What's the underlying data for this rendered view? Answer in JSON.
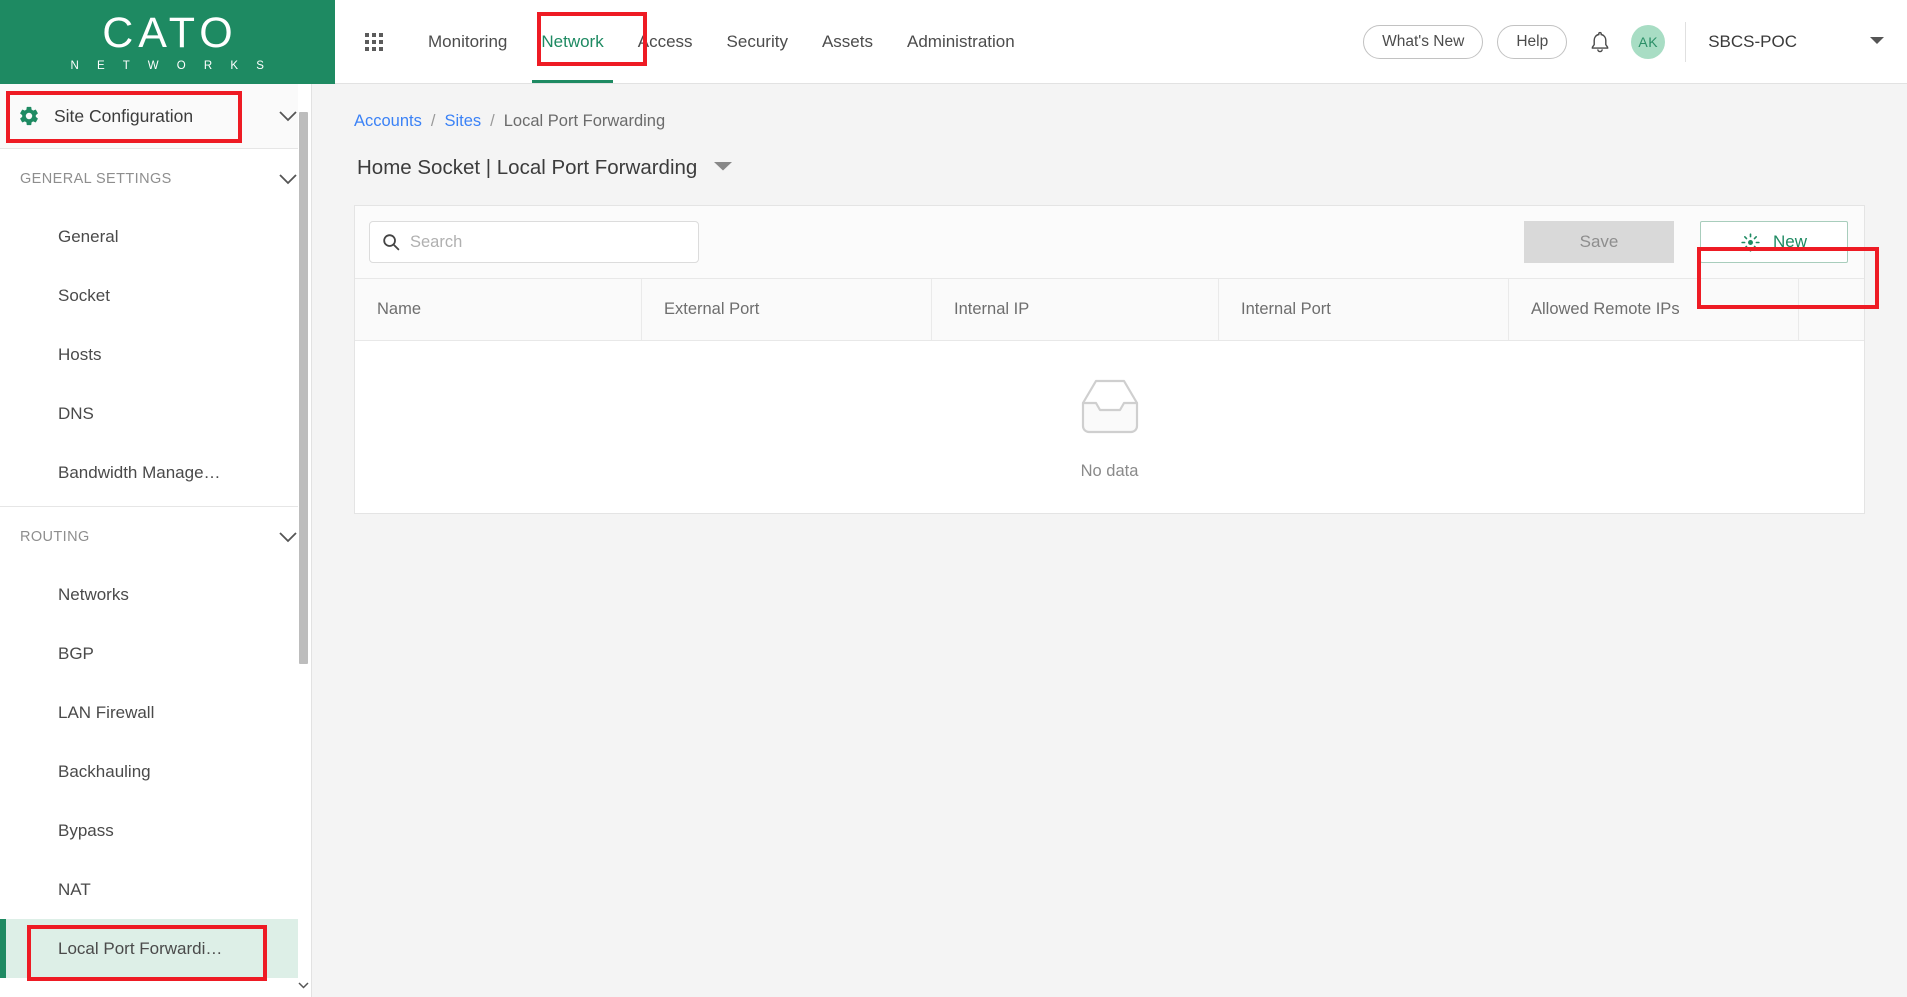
{
  "brand": {
    "name": "CATO",
    "tagline": "N E T W O R K S"
  },
  "topnav": {
    "apps_icon": "grid-apps-icon",
    "items": [
      {
        "label": "Monitoring",
        "active": false
      },
      {
        "label": "Network",
        "active": true
      },
      {
        "label": "Access",
        "active": false
      },
      {
        "label": "Security",
        "active": false
      },
      {
        "label": "Assets",
        "active": false
      },
      {
        "label": "Administration",
        "active": false
      }
    ],
    "whats_new_label": "What's New",
    "help_label": "Help",
    "notifications_icon": "bell-icon",
    "avatar_initials": "AK",
    "account_name": "SBCS-POC",
    "account_caret_icon": "chevron-down-icon"
  },
  "sidebar": {
    "header": {
      "label": "Site Configuration",
      "icon": "gear-icon",
      "caret_icon": "chevron-down-icon"
    },
    "sections": [
      {
        "title": "GENERAL SETTINGS",
        "caret_icon": "chevron-down-icon",
        "items": [
          {
            "label": "General",
            "selected": false
          },
          {
            "label": "Socket",
            "selected": false
          },
          {
            "label": "Hosts",
            "selected": false
          },
          {
            "label": "DNS",
            "selected": false
          },
          {
            "label": "Bandwidth Manage…",
            "selected": false
          }
        ]
      },
      {
        "title": "ROUTING",
        "caret_icon": "chevron-down-icon",
        "items": [
          {
            "label": "Networks",
            "selected": false
          },
          {
            "label": "BGP",
            "selected": false
          },
          {
            "label": "LAN Firewall",
            "selected": false
          },
          {
            "label": "Backhauling",
            "selected": false
          },
          {
            "label": "Bypass",
            "selected": false
          },
          {
            "label": "NAT",
            "selected": false
          },
          {
            "label": "Local Port Forwardi…",
            "selected": true
          }
        ]
      }
    ],
    "scroll_down_icon": "chevron-down-icon"
  },
  "breadcrumb": {
    "items": [
      {
        "label": "Accounts",
        "link": true
      },
      {
        "label": "Sites",
        "link": true
      },
      {
        "label": "Local Port Forwarding",
        "link": false
      }
    ],
    "separator": "/"
  },
  "page": {
    "title": "Home Socket | Local Port Forwarding",
    "title_caret_icon": "caret-down-icon"
  },
  "toolbar": {
    "search_placeholder": "Search",
    "search_value": "",
    "search_icon": "search-icon",
    "save_label": "Save",
    "save_disabled": true,
    "new_label": "New",
    "new_icon": "starburst-icon"
  },
  "table": {
    "columns": [
      "Name",
      "External Port",
      "Internal IP",
      "Internal Port",
      "Allowed Remote IPs"
    ],
    "rows": [],
    "empty_label": "No data",
    "empty_icon": "empty-inbox-icon"
  },
  "annotations": [
    {
      "name": "site-configuration-highlight"
    },
    {
      "name": "network-tab-highlight"
    },
    {
      "name": "new-button-highlight"
    },
    {
      "name": "local-port-forwarding-highlight"
    }
  ],
  "colors": {
    "brand_green": "#1e8a62",
    "annotation_red": "#ee1b24",
    "link_blue": "#3b82f6",
    "selected_bg": "#ddefe7"
  }
}
